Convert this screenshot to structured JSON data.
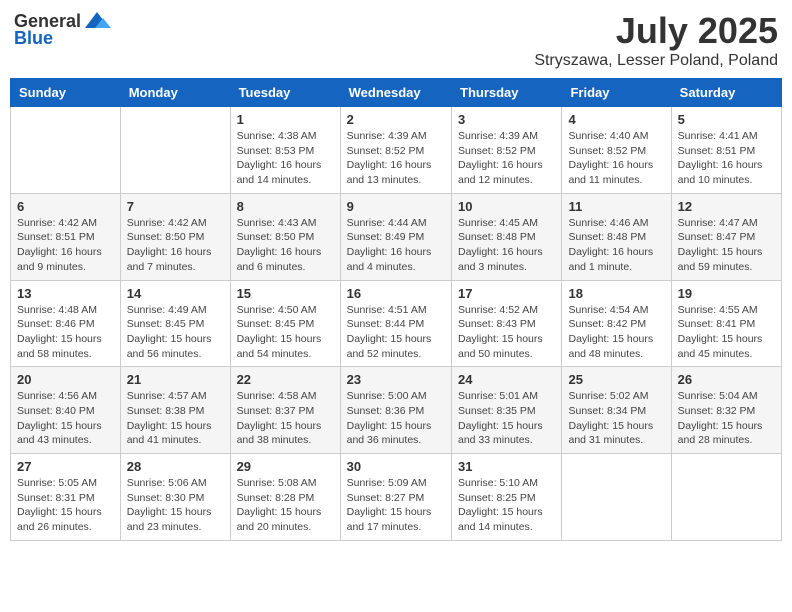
{
  "header": {
    "logo_general": "General",
    "logo_blue": "Blue",
    "title": "July 2025",
    "subtitle": "Stryszawa, Lesser Poland, Poland"
  },
  "calendar": {
    "headers": [
      "Sunday",
      "Monday",
      "Tuesday",
      "Wednesday",
      "Thursday",
      "Friday",
      "Saturday"
    ],
    "weeks": [
      [
        {
          "day": "",
          "info": ""
        },
        {
          "day": "",
          "info": ""
        },
        {
          "day": "1",
          "info": "Sunrise: 4:38 AM\nSunset: 8:53 PM\nDaylight: 16 hours and 14 minutes."
        },
        {
          "day": "2",
          "info": "Sunrise: 4:39 AM\nSunset: 8:52 PM\nDaylight: 16 hours and 13 minutes."
        },
        {
          "day": "3",
          "info": "Sunrise: 4:39 AM\nSunset: 8:52 PM\nDaylight: 16 hours and 12 minutes."
        },
        {
          "day": "4",
          "info": "Sunrise: 4:40 AM\nSunset: 8:52 PM\nDaylight: 16 hours and 11 minutes."
        },
        {
          "day": "5",
          "info": "Sunrise: 4:41 AM\nSunset: 8:51 PM\nDaylight: 16 hours and 10 minutes."
        }
      ],
      [
        {
          "day": "6",
          "info": "Sunrise: 4:42 AM\nSunset: 8:51 PM\nDaylight: 16 hours and 9 minutes."
        },
        {
          "day": "7",
          "info": "Sunrise: 4:42 AM\nSunset: 8:50 PM\nDaylight: 16 hours and 7 minutes."
        },
        {
          "day": "8",
          "info": "Sunrise: 4:43 AM\nSunset: 8:50 PM\nDaylight: 16 hours and 6 minutes."
        },
        {
          "day": "9",
          "info": "Sunrise: 4:44 AM\nSunset: 8:49 PM\nDaylight: 16 hours and 4 minutes."
        },
        {
          "day": "10",
          "info": "Sunrise: 4:45 AM\nSunset: 8:48 PM\nDaylight: 16 hours and 3 minutes."
        },
        {
          "day": "11",
          "info": "Sunrise: 4:46 AM\nSunset: 8:48 PM\nDaylight: 16 hours and 1 minute."
        },
        {
          "day": "12",
          "info": "Sunrise: 4:47 AM\nSunset: 8:47 PM\nDaylight: 15 hours and 59 minutes."
        }
      ],
      [
        {
          "day": "13",
          "info": "Sunrise: 4:48 AM\nSunset: 8:46 PM\nDaylight: 15 hours and 58 minutes."
        },
        {
          "day": "14",
          "info": "Sunrise: 4:49 AM\nSunset: 8:45 PM\nDaylight: 15 hours and 56 minutes."
        },
        {
          "day": "15",
          "info": "Sunrise: 4:50 AM\nSunset: 8:45 PM\nDaylight: 15 hours and 54 minutes."
        },
        {
          "day": "16",
          "info": "Sunrise: 4:51 AM\nSunset: 8:44 PM\nDaylight: 15 hours and 52 minutes."
        },
        {
          "day": "17",
          "info": "Sunrise: 4:52 AM\nSunset: 8:43 PM\nDaylight: 15 hours and 50 minutes."
        },
        {
          "day": "18",
          "info": "Sunrise: 4:54 AM\nSunset: 8:42 PM\nDaylight: 15 hours and 48 minutes."
        },
        {
          "day": "19",
          "info": "Sunrise: 4:55 AM\nSunset: 8:41 PM\nDaylight: 15 hours and 45 minutes."
        }
      ],
      [
        {
          "day": "20",
          "info": "Sunrise: 4:56 AM\nSunset: 8:40 PM\nDaylight: 15 hours and 43 minutes."
        },
        {
          "day": "21",
          "info": "Sunrise: 4:57 AM\nSunset: 8:38 PM\nDaylight: 15 hours and 41 minutes."
        },
        {
          "day": "22",
          "info": "Sunrise: 4:58 AM\nSunset: 8:37 PM\nDaylight: 15 hours and 38 minutes."
        },
        {
          "day": "23",
          "info": "Sunrise: 5:00 AM\nSunset: 8:36 PM\nDaylight: 15 hours and 36 minutes."
        },
        {
          "day": "24",
          "info": "Sunrise: 5:01 AM\nSunset: 8:35 PM\nDaylight: 15 hours and 33 minutes."
        },
        {
          "day": "25",
          "info": "Sunrise: 5:02 AM\nSunset: 8:34 PM\nDaylight: 15 hours and 31 minutes."
        },
        {
          "day": "26",
          "info": "Sunrise: 5:04 AM\nSunset: 8:32 PM\nDaylight: 15 hours and 28 minutes."
        }
      ],
      [
        {
          "day": "27",
          "info": "Sunrise: 5:05 AM\nSunset: 8:31 PM\nDaylight: 15 hours and 26 minutes."
        },
        {
          "day": "28",
          "info": "Sunrise: 5:06 AM\nSunset: 8:30 PM\nDaylight: 15 hours and 23 minutes."
        },
        {
          "day": "29",
          "info": "Sunrise: 5:08 AM\nSunset: 8:28 PM\nDaylight: 15 hours and 20 minutes."
        },
        {
          "day": "30",
          "info": "Sunrise: 5:09 AM\nSunset: 8:27 PM\nDaylight: 15 hours and 17 minutes."
        },
        {
          "day": "31",
          "info": "Sunrise: 5:10 AM\nSunset: 8:25 PM\nDaylight: 15 hours and 14 minutes."
        },
        {
          "day": "",
          "info": ""
        },
        {
          "day": "",
          "info": ""
        }
      ]
    ]
  }
}
